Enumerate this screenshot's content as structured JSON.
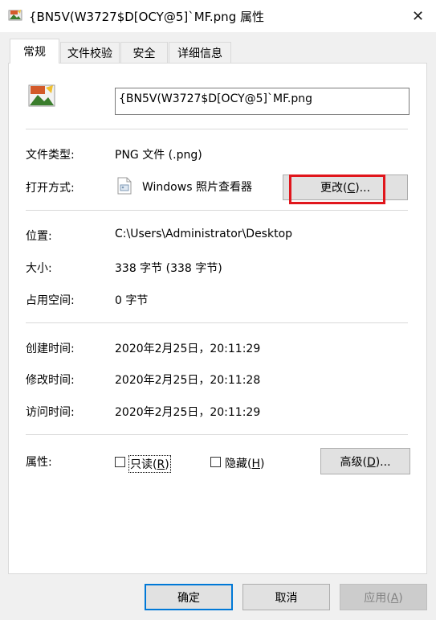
{
  "window": {
    "title": "{BN5V(W3727$D[OCY@5]`MF.png 属性",
    "close_glyph": "✕"
  },
  "tabs": [
    {
      "label": "常规",
      "active": true
    },
    {
      "label": "文件校验",
      "active": false
    },
    {
      "label": "安全",
      "active": false
    },
    {
      "label": "详细信息",
      "active": false
    }
  ],
  "general": {
    "filename": "{BN5V(W3727$D[OCY@5]`MF.png",
    "file_type_label": "文件类型:",
    "file_type_value": "PNG 文件 (.png)",
    "opens_with_label": "打开方式:",
    "opens_with_value": "Windows 照片查看器",
    "change_button": {
      "text": "更改(",
      "key": "C",
      "suffix": ")..."
    },
    "location_label": "位置:",
    "location_value": "C:\\Users\\Administrator\\Desktop",
    "size_label": "大小:",
    "size_value": "338 字节 (338 字节)",
    "size_on_disk_label": "占用空间:",
    "size_on_disk_value": "0 字节",
    "created_label": "创建时间:",
    "created_value": "2020年2月25日，20:11:29",
    "modified_label": "修改时间:",
    "modified_value": "2020年2月25日，20:11:28",
    "accessed_label": "访问时间:",
    "accessed_value": "2020年2月25日，20:11:29",
    "attributes_label": "属性:",
    "readonly": {
      "text": "只读(",
      "key": "R",
      "suffix": ")"
    },
    "hidden": {
      "text": "隐藏(",
      "key": "H",
      "suffix": ")"
    },
    "advanced_button": {
      "text": "高级(",
      "key": "D",
      "suffix": ")..."
    }
  },
  "footer": {
    "ok": "确定",
    "cancel": "取消",
    "apply": {
      "text": "应用(",
      "key": "A",
      "suffix": ")"
    }
  },
  "colors": {
    "highlight": "#e0161c",
    "primary_border": "#0078d7"
  },
  "icons": {
    "title": "image-file-icon",
    "large": "image-file-icon",
    "opens_with": "photo-viewer-icon"
  }
}
